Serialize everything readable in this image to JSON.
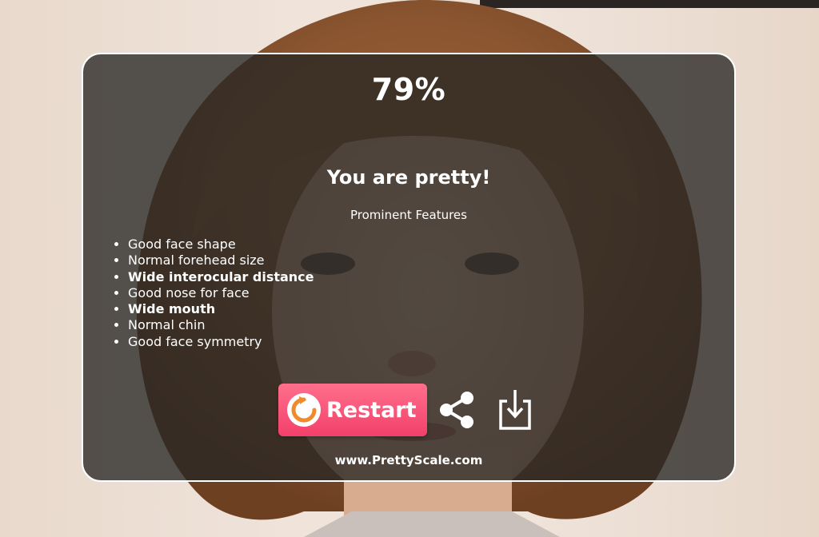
{
  "result": {
    "score": "79%",
    "verdict": "You are pretty!",
    "features_heading": "Prominent Features",
    "features": [
      {
        "label": "Good face shape",
        "emphasis": false
      },
      {
        "label": "Normal forehead size",
        "emphasis": false
      },
      {
        "label": "Wide interocular distance",
        "emphasis": true
      },
      {
        "label": "Good nose for face",
        "emphasis": false
      },
      {
        "label": "Wide mouth",
        "emphasis": true
      },
      {
        "label": "Normal chin",
        "emphasis": false
      },
      {
        "label": "Good face symmetry",
        "emphasis": false
      }
    ]
  },
  "actions": {
    "restart_label": "Restart",
    "restart_icon": "restart-icon",
    "share_icon": "share-icon",
    "download_icon": "download-icon"
  },
  "footer": {
    "site_url": "www.PrettyScale.com"
  },
  "colors": {
    "restart_button": "#f2406a",
    "restart_icon_accent": "#f08a2a",
    "card_border": "#ffffff"
  }
}
